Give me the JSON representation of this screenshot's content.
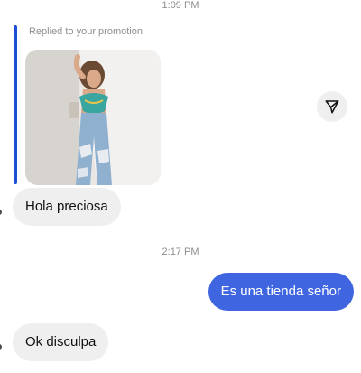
{
  "conversation": {
    "timestamp_top": "1:09 PM",
    "reply_label": "Replied to your promotion",
    "msg_hola": "Hola preciosa",
    "timestamp_mid": "2:17 PM",
    "msg_tienda": "Es una tienda señor",
    "msg_ok": "Ok disculpa"
  },
  "colors": {
    "outgoing_bubble": "#3f66e0",
    "incoming_bubble": "#efefef",
    "reply_bar": "#1b4fd4"
  },
  "icons": {
    "share": "send-arrow-icon"
  }
}
